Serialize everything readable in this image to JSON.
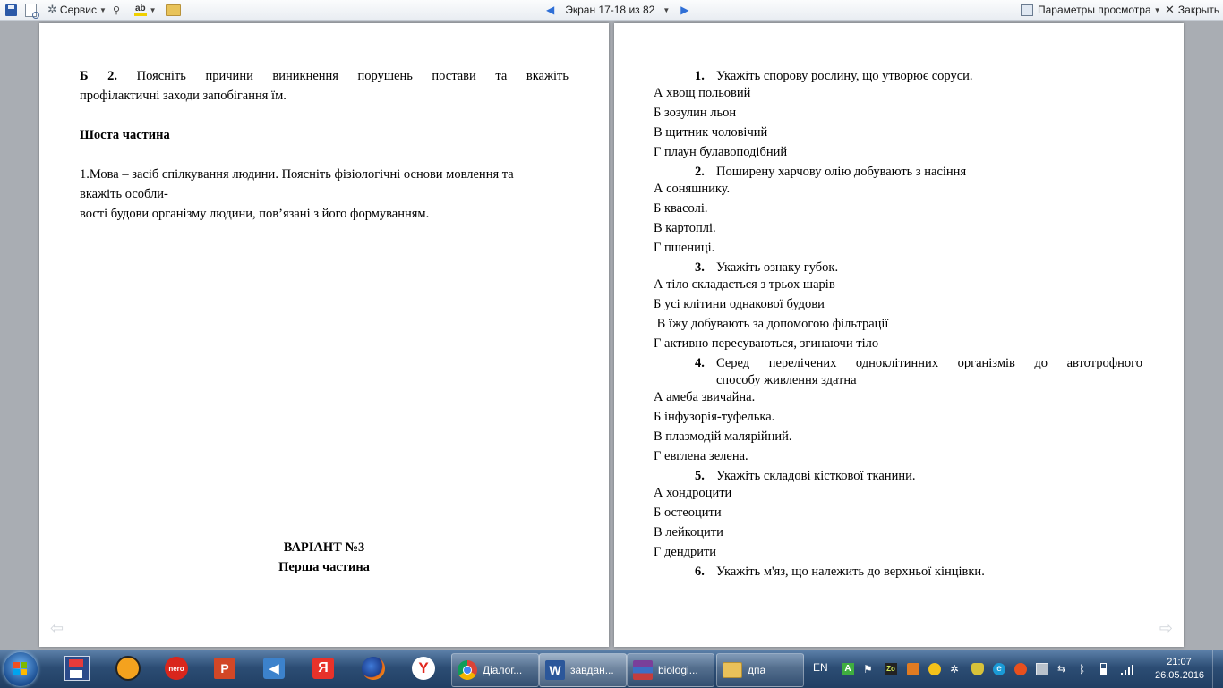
{
  "toolbar": {
    "tools_label": "Сервис",
    "screen_label": "Экран 17-18 из 82",
    "view_options_label": "Параметры просмотра",
    "close_label": "Закрыть"
  },
  "left_page": {
    "b2_label": "Б 2.",
    "b2_text": "Поясніть причини виникнення порушень постави та вкажіть",
    "b2_text_cont": "профілактичні заходи запобігання їм.",
    "section_six": "Шоста частина",
    "essay_line1": "1.Мова – засіб спілкування людини. Поясніть фізіологічні основи мовлення та",
    "essay_line2": "вкажіть особли-",
    "essay_line3": "вості будови організму людини, пов’язані з його формуванням.",
    "variant_title": "ВАРІАНТ №3",
    "part_one": "Перша частина"
  },
  "right_page": {
    "questions": [
      {
        "num": "1.",
        "text": "Укажіть спорову рослину, що утворює соруси.",
        "options": [
          "А хвощ польовий",
          "Б зозулин льон",
          "В щитник чоловічий",
          "Г плаун булавоподібний"
        ]
      },
      {
        "num": "2.",
        "text": "Поширену харчову олію добувають з насіння",
        "options": [
          "А соняшнику.",
          "Б квасолі.",
          "В картоплі.",
          "Г пшениці."
        ]
      },
      {
        "num": "3.",
        "text": "Укажіть ознаку губок.",
        "options": [
          "А тіло складається з трьох шарів",
          "Б усі клітини однакової будови",
          " В їжу добувають за допомогою фільтрації",
          "Г активно пересуваються, згинаючи тіло"
        ]
      },
      {
        "num": "4.",
        "text": "Серед перелічених одноклітинних організмів до автотрофного",
        "text_cont": "способу живлення здатна",
        "options": [
          "А амеба звичайна.",
          "Б інфузорія-туфелька.",
          "В плазмодій малярійний.",
          "Г евглена зелена."
        ]
      },
      {
        "num": "5.",
        "text": "Укажіть складові кісткової тканини.",
        "options": [
          "А хондроцити",
          "Б остеоцити",
          "В лейкоцити",
          "Г дендрити"
        ]
      },
      {
        "num": "6.",
        "text": "Укажіть м'яз, що належить до верхньої кінцівки."
      }
    ]
  },
  "taskbar": {
    "tasks": [
      "Діалог...",
      "завдан...",
      "biologi...",
      "дпа"
    ],
    "language": "EN",
    "time": "21:07",
    "date": "26.05.2016"
  }
}
